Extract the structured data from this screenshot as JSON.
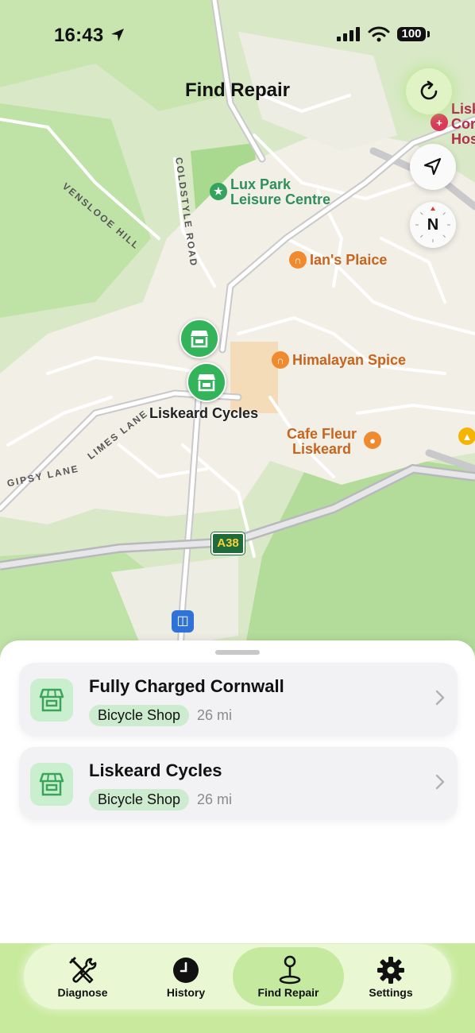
{
  "status_bar": {
    "time": "16:43",
    "battery": "100"
  },
  "header": {
    "title": "Find Repair"
  },
  "map": {
    "places": [
      {
        "name": "Lux Park\nLeisure Centre",
        "color": "#2f8f5b"
      },
      {
        "name": "Ian's Plaice",
        "color": "#c7641e"
      },
      {
        "name": "Himalayan Spice",
        "color": "#c7641e"
      },
      {
        "name": "Cafe Fleur\nLiskeard",
        "color": "#c7641e"
      },
      {
        "name": "Lisk\nCor\nHos",
        "color": "#b03049"
      }
    ],
    "pin_label": "Liskeard Cycles",
    "roads": [
      "VENSLOOE HILL",
      "COLDSTYLE ROAD",
      "LIMES LANE",
      "GIPSY LANE"
    ],
    "road_shield": "A38",
    "compass_label": "N"
  },
  "results": [
    {
      "name": "Fully Charged Cornwall",
      "category": "Bicycle Shop",
      "distance": "26 mi"
    },
    {
      "name": "Liskeard Cycles",
      "category": "Bicycle Shop",
      "distance": "26 mi"
    }
  ],
  "tabs": [
    {
      "label": "Diagnose",
      "icon": "tools-icon"
    },
    {
      "label": "History",
      "icon": "clock-icon"
    },
    {
      "label": "Find Repair",
      "icon": "map-pin-icon",
      "active": true
    },
    {
      "label": "Settings",
      "icon": "gear-icon"
    }
  ],
  "colors": {
    "accent_green": "#34b45a",
    "tab_bar": "#e9f7d3",
    "map_park": "#bfe3a7"
  }
}
